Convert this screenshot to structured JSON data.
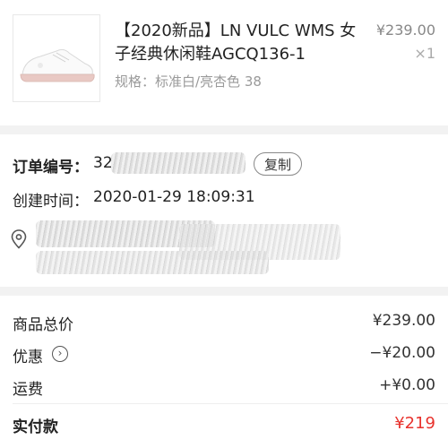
{
  "product": {
    "title": "【2020新品】LN VULC WMS 女子经典休闲鞋AGCQ136-1",
    "spec": "规格：标准白/亮杏色 38",
    "price": "¥239.00",
    "quantity": "×1"
  },
  "order": {
    "number_label": "订单编号：",
    "number_value": "32",
    "copy_label": "复制",
    "created_label": "创建时间：",
    "created_value": "2020-01-29 18:09:31",
    "address_icon": "location-pin-icon"
  },
  "summary": {
    "goods_label": "商品总价",
    "goods_value": "¥239.00",
    "discount_label": "优惠",
    "discount_icon": "chevron-right-circle-icon",
    "discount_value": "−¥20.00",
    "shipping_label": "运费",
    "shipping_value": "+¥0.00",
    "paid_label": "实付款",
    "paid_value": "¥219"
  },
  "colors": {
    "accent_red": "#e8322d",
    "background": "#f2f2f2"
  }
}
